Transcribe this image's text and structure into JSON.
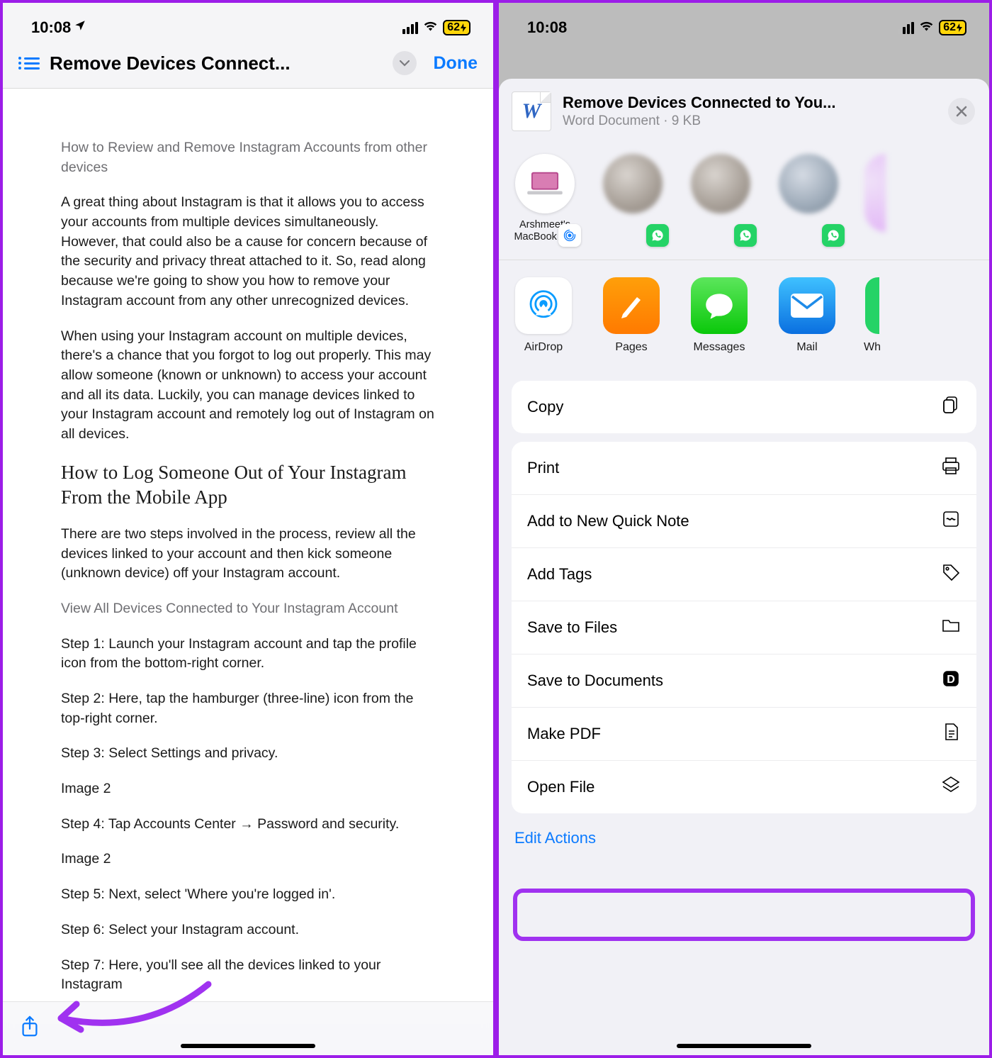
{
  "left": {
    "status": {
      "time": "10:08",
      "battery": "62"
    },
    "header": {
      "title": "Remove Devices Connect...",
      "done": "Done"
    },
    "doc": {
      "subtitle": "How to Review and Remove Instagram Accounts from other devices",
      "p1": "A great thing about Instagram is that it allows you to access your accounts from multiple devices simultaneously. However, that could also be a cause for concern because of the security and privacy threat attached to it. So, read along because we're going to show you how to remove your Instagram account from any other unrecognized devices.",
      "p2": "When using your Instagram account on multiple devices, there's a chance that you forgot to log out properly. This may allow someone (known or unknown) to access your account and all its data. Luckily, you can manage devices linked to your Instagram account and remotely log out of Instagram on all devices.",
      "h2": "How to Log Someone Out of Your Instagram From the Mobile App",
      "p3": "There are two steps involved in the process, review all the devices linked to your account and then kick someone (unknown device) off your Instagram account.",
      "section": "View All Devices Connected to Your Instagram Account",
      "s1": "Step 1: Launch your Instagram account and tap the profile icon from the bottom-right corner.",
      "s2": "Step 2: Here, tap the hamburger (three-line) icon from the top-right corner.",
      "s3": "Step 3: Select Settings and privacy.",
      "i2a": "Image 2",
      "s4": "Step 4: Tap Accounts Center → Password and security.",
      "i2b": "Image 2",
      "s5": "Step 5: Next, select 'Where you're logged in'.",
      "s6": "Step 6: Select your Instagram account.",
      "s7": "Step 7: Here, you'll see all the devices linked to your Instagram"
    }
  },
  "right": {
    "status": {
      "time": "10:08",
      "battery": "62"
    },
    "sheet": {
      "title": "Remove Devices Connected to You...",
      "subtitle": "Word Document · 9 KB",
      "contact_airdrop": "Arshmeet's MacBook Pro",
      "apps": {
        "airdrop": "AirDrop",
        "pages": "Pages",
        "messages": "Messages",
        "mail": "Mail",
        "wh": "Wh"
      },
      "actions": {
        "copy": "Copy",
        "print": "Print",
        "quicknote": "Add to New Quick Note",
        "tags": "Add Tags",
        "save_files": "Save to Files",
        "save_docs": "Save to Documents",
        "make_pdf": "Make PDF",
        "open_file": "Open File"
      },
      "edit": "Edit Actions"
    }
  }
}
